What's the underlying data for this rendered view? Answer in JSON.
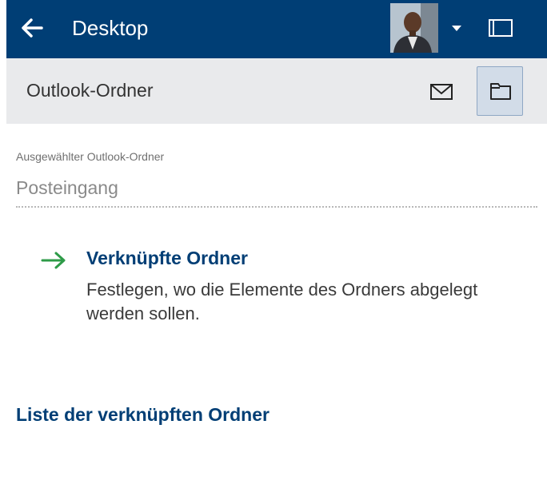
{
  "header": {
    "title": "Desktop",
    "back_icon": "arrow-left-icon",
    "avatar": "user-avatar",
    "menu_icon": "caret-down-icon",
    "panel_icon": "panel-icon",
    "background": "#003e75"
  },
  "subbar": {
    "title": "Outlook-Ordner",
    "mail_icon": "mail-icon",
    "folder_icon": "folder-icon"
  },
  "field": {
    "label": "Ausgewählter Outlook-Ordner",
    "value": "Posteingang"
  },
  "action": {
    "icon": "arrow-right-icon",
    "title": "Verknüpfte Ordner",
    "description": "Festlegen, wo die Elemente des Ordners abgelegt werden sollen."
  },
  "section": {
    "title": "Liste der verknüpften Ordner"
  },
  "colors": {
    "accent": "#003e75",
    "arrow": "#2e9b48"
  }
}
